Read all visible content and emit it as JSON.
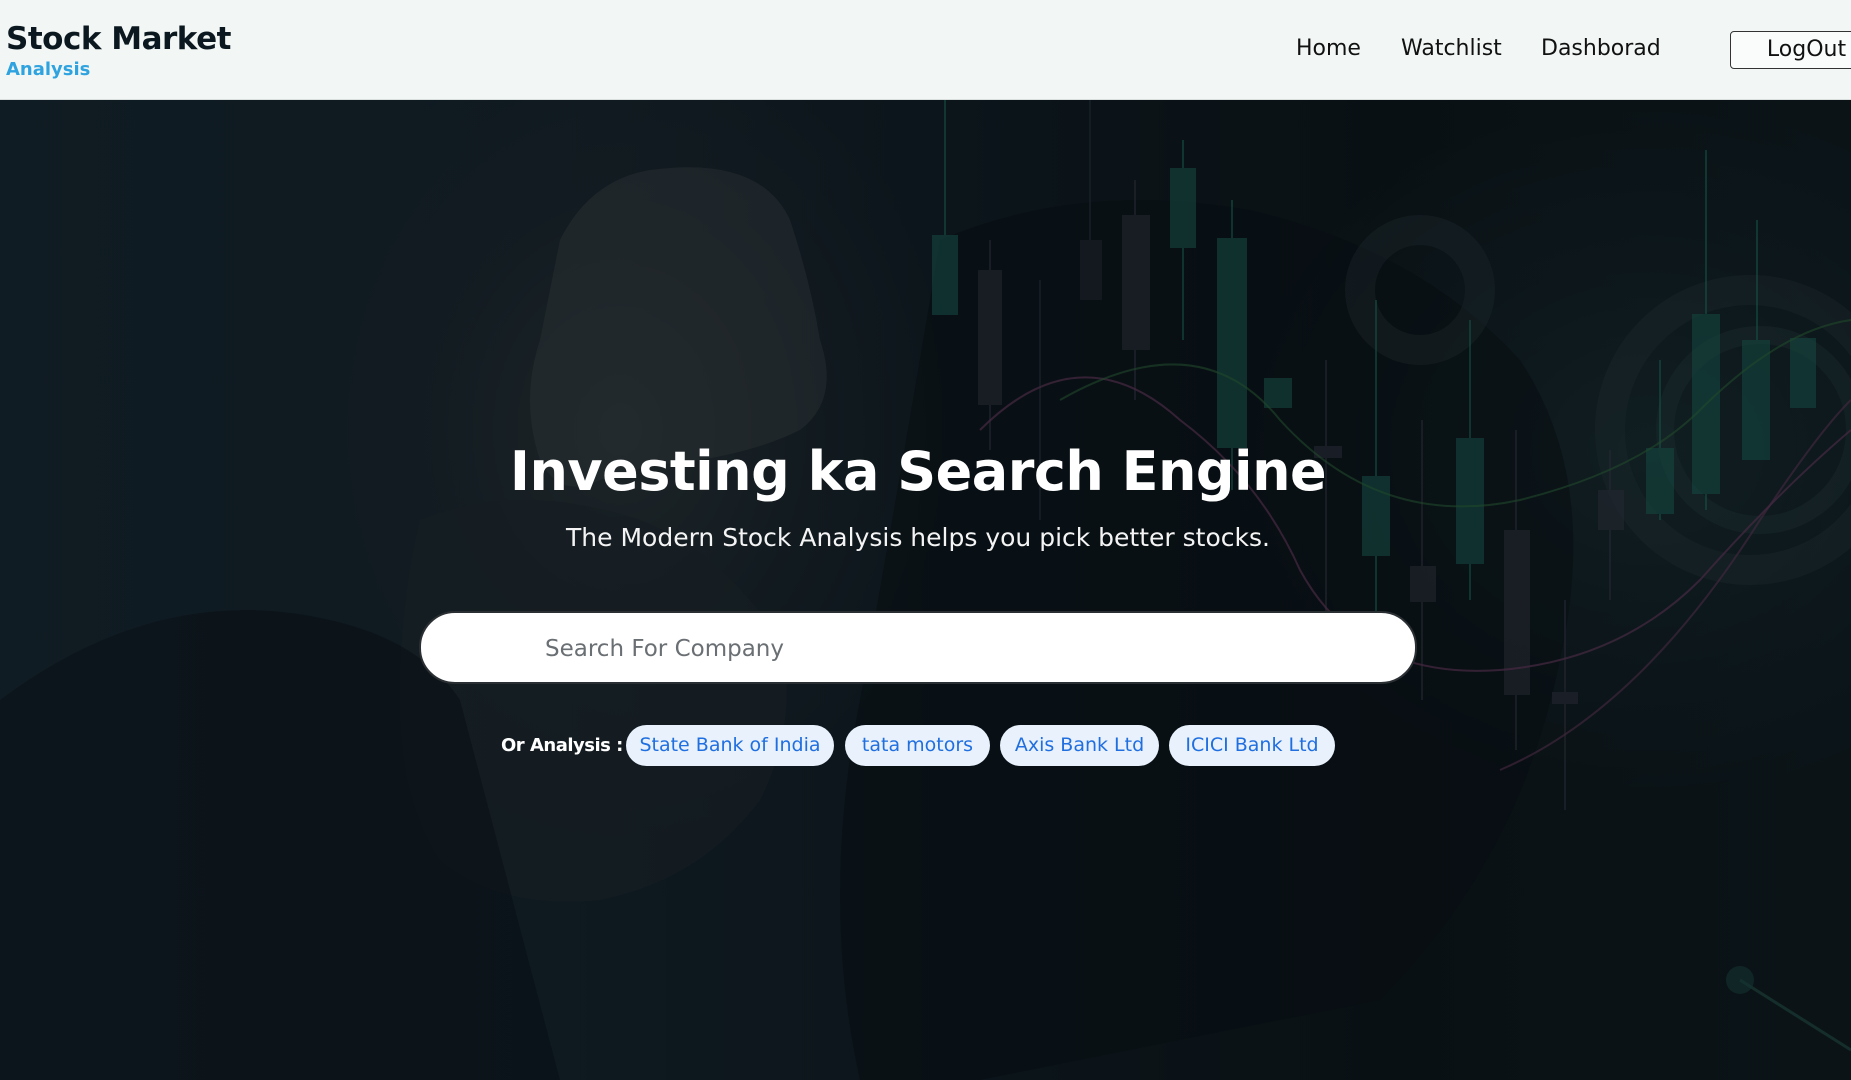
{
  "brand": {
    "title": "Stock Market",
    "subtitle": "Analysis"
  },
  "nav": {
    "items": [
      {
        "label": "Home"
      },
      {
        "label": "Watchlist"
      },
      {
        "label": "Dashborad"
      }
    ],
    "logout_label": "LogOut"
  },
  "hero": {
    "title": "Investing ka Search Engine",
    "subtitle": "The Modern Stock Analysis helps you pick better stocks."
  },
  "search": {
    "placeholder": "Search For Company",
    "value": ""
  },
  "quick_analysis": {
    "label": "Or Analysis :",
    "chips": [
      {
        "label": "State Bank of India"
      },
      {
        "label": "tata motors"
      },
      {
        "label": "Axis Bank Ltd"
      },
      {
        "label": "ICICI Bank Ltd"
      }
    ]
  },
  "colors": {
    "navbar_bg": "#f2f7f5",
    "brand_accent": "#2fa3df",
    "chip_bg": "#e8f1fc",
    "chip_text": "#1f6fe0",
    "hero_bg": "#0f1a20"
  },
  "icons": []
}
